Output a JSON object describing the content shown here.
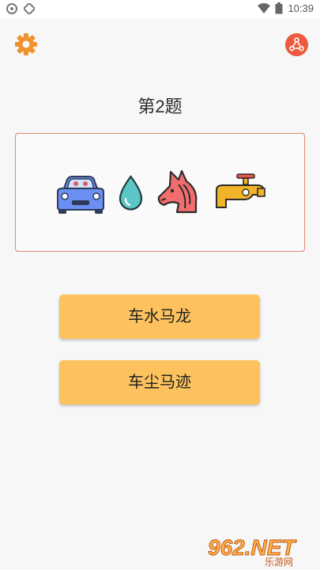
{
  "status_bar": {
    "time": "10:39",
    "icons": [
      "notification-icon",
      "notification-icon",
      "wifi-icon",
      "battery-icon"
    ]
  },
  "toolbar": {
    "settings_icon": "gear-icon",
    "share_icon": "share-icon"
  },
  "question": {
    "title": "第2题",
    "emojis": [
      "car-emoji",
      "water-drop-emoji",
      "horse-emoji",
      "faucet-emoji"
    ]
  },
  "answers": [
    {
      "label": "车水马龙"
    },
    {
      "label": "车尘马迹"
    }
  ],
  "watermark": {
    "brand": "962.NET",
    "subtitle": "乐游网"
  },
  "colors": {
    "accent": "#f0932f",
    "share_bg": "#ec5b40",
    "answer_bg": "#fdc25d",
    "puzzle_border": "#df8a6c"
  }
}
